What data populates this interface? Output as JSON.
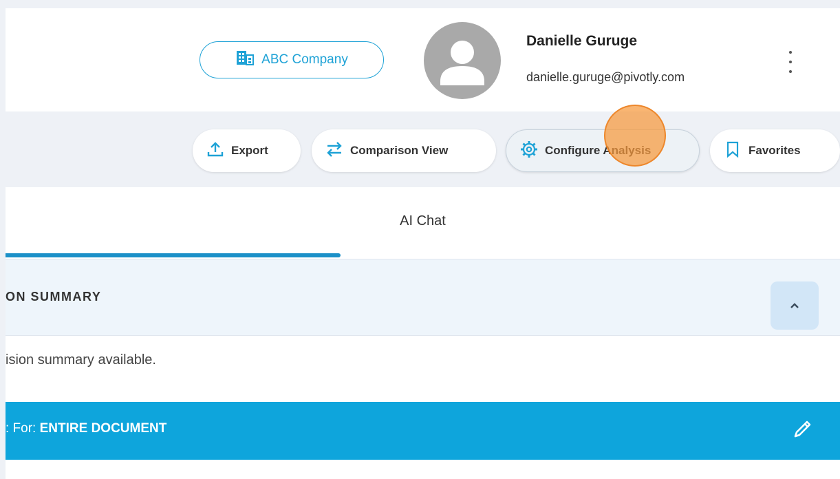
{
  "header": {
    "company_label": "ABC Company",
    "user_name": "Danielle Guruge",
    "user_email": "danielle.guruge@pivotly.com"
  },
  "toolbar": {
    "export_label": "Export",
    "comparison_label": "Comparison View",
    "configure_label": "Configure Analysis",
    "favorites_label": "Favorites"
  },
  "tabs": {
    "ai_chat_label": "AI Chat"
  },
  "accordion": {
    "title": "ON SUMMARY",
    "summary_text": "ision summary available."
  },
  "selection": {
    "prefix": ": For: ",
    "value": "ENTIRE DOCUMENT"
  },
  "colors": {
    "accent": "#1ea2d6",
    "selection_bar": "#0ea5dc",
    "tab_underline": "#1b90c8"
  },
  "icons": {
    "company": "building-icon",
    "export": "upload-icon",
    "comparison": "swap-arrows-icon",
    "configure": "gear-icon",
    "favorites": "bookmark-icon",
    "menu": "kebab-icon",
    "collapse": "chevron-up-icon",
    "edit": "pencil-icon"
  }
}
